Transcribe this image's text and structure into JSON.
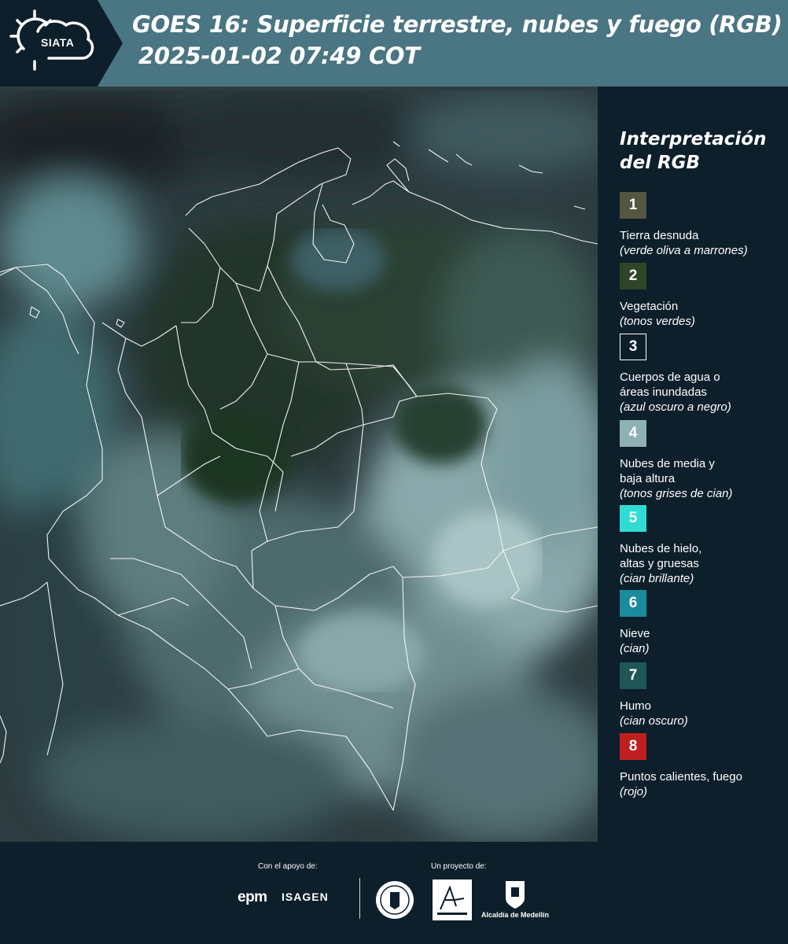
{
  "header": {
    "title_line1": "GOES 16: Superficie terrestre, nubes y fuego (RGB)",
    "title_line2": "2025-01-02 07:49 COT",
    "logo_text": "SIATA"
  },
  "legend": {
    "title": "Interpretación del RGB",
    "items": [
      {
        "number": "1",
        "label": "Tierra desnuda",
        "sub": "(verde oliva a marrones)",
        "color": "#545641"
      },
      {
        "number": "2",
        "label": "Vegetación",
        "sub": "(tonos verdes)",
        "color": "#2f4527"
      },
      {
        "number": "3",
        "label": "Cuerpos de agua o áreas inundadas",
        "sub": "(azul oscuro a negro)",
        "color": "#0d1f2b"
      },
      {
        "number": "4",
        "label": "Nubes de media y baja altura",
        "sub": "(tonos grises de cian)",
        "color": "#8eb2b4"
      },
      {
        "number": "5",
        "label": "Nubes de hielo, altas y gruesas",
        "sub": "(cian brillante)",
        "color": "#2fdcd4"
      },
      {
        "number": "6",
        "label": "Nieve",
        "sub": "(cian)",
        "color": "#1a8c9c"
      },
      {
        "number": "7",
        "label": "Humo",
        "sub": "(cian oscuro)",
        "color": "#1f5658"
      },
      {
        "number": "8",
        "label": "Puntos calientes, fuego",
        "sub": "(rojo)",
        "color": "#c01f1f"
      }
    ]
  },
  "footer": {
    "support_caption": "Con el apoyo de:",
    "project_caption": "Un proyecto de:",
    "sponsor1": "epm",
    "sponsor2": "ISAGEN",
    "org3": "Alcaldía de Medellín"
  }
}
